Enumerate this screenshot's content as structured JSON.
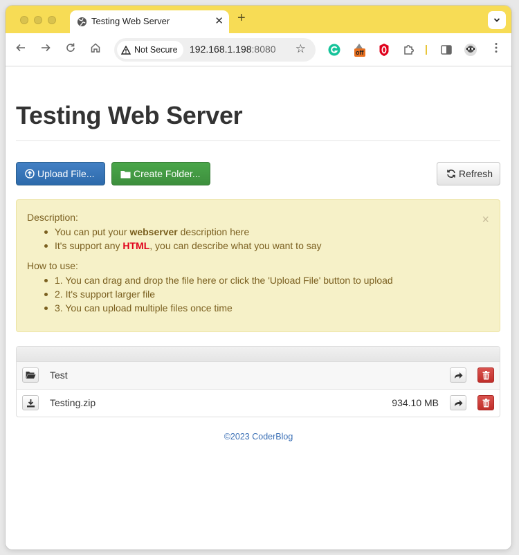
{
  "browser": {
    "tab_title": "Testing Web Server",
    "tab_close": "✕",
    "new_tab": "+",
    "tab_menu": "⌄",
    "security_label": "Not Secure",
    "url_host": "192.168.1.198",
    "url_port": ":8080",
    "extension_badge": "off",
    "theme_color": "#f7dc55"
  },
  "page": {
    "title": "Testing Web Server",
    "buttons": {
      "upload": "Upload File...",
      "create_folder": "Create Folder...",
      "refresh": "Refresh"
    },
    "alert": {
      "close": "×",
      "description_heading": "Description:",
      "description_1_pre": "You can put your ",
      "description_1_bold": "webserver",
      "description_1_post": " description here",
      "description_2_pre": "It's support any ",
      "description_2_bold": "HTML",
      "description_2_post": ", you can describe what you want to say",
      "howto_heading": "How to use:",
      "howto_items": [
        "1. You can drag and drop the file here or click the 'Upload File' button to upload",
        "2. It's support larger file",
        "3. You can upload multiple files once time"
      ]
    },
    "files": [
      {
        "type": "folder",
        "name": "Test",
        "size": ""
      },
      {
        "type": "file",
        "name": "Testing.zip",
        "size": "934.10 MB"
      }
    ],
    "footer": "©2023 CoderBlog"
  }
}
